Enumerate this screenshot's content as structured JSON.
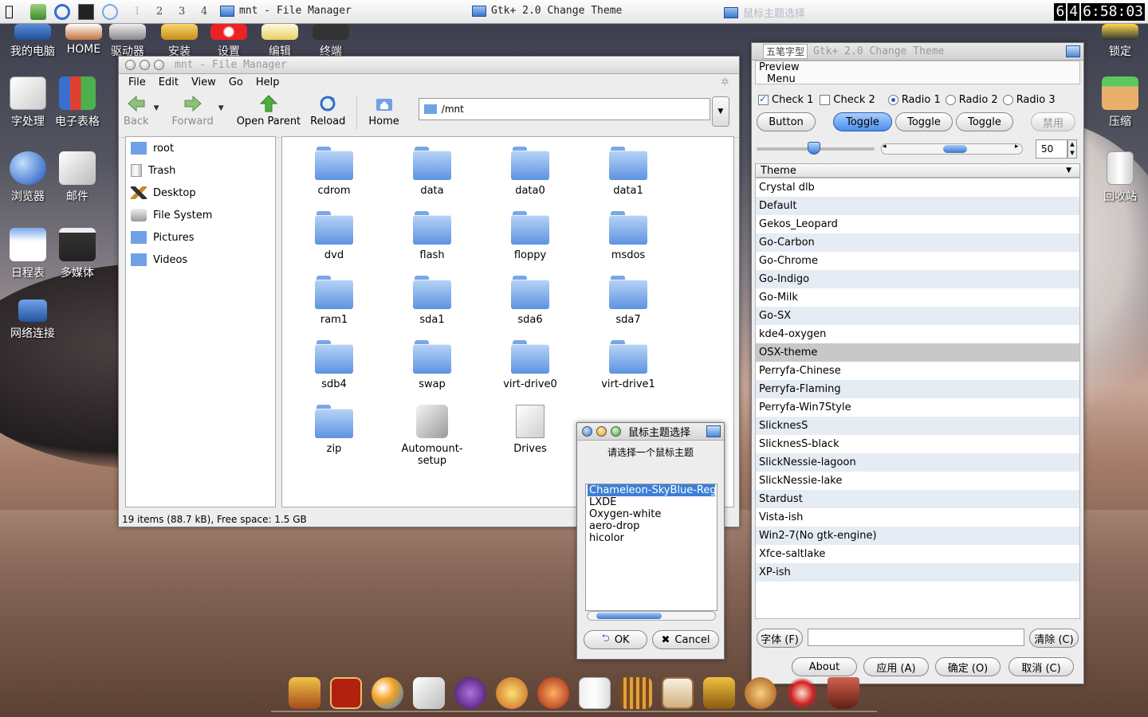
{
  "top_panel": {
    "workspaces": [
      "1",
      "2",
      "3",
      "4"
    ],
    "tasks": [
      "mnt - File Manager",
      "Gtk+ 2.0 Change Theme",
      "鼠标主题选择"
    ],
    "clock": {
      "a": "6",
      "b": "4",
      "time": "6:58:03"
    }
  },
  "desktop_left": [
    {
      "label": "我的电脑",
      "icon": "computer-icon"
    },
    {
      "label": "HOME",
      "icon": "home-icon"
    },
    {
      "label": "驱动器",
      "icon": "drive-icon"
    },
    {
      "label": "安装",
      "icon": "package-icon"
    },
    {
      "label": "设置",
      "icon": "settings-icon"
    },
    {
      "label": "编辑",
      "icon": "editor-icon"
    },
    {
      "label": "终端",
      "icon": "terminal-icon"
    },
    {
      "label": "字处理",
      "icon": "word-processor-icon"
    },
    {
      "label": "电子表格",
      "icon": "spreadsheet-icon"
    },
    {
      "label": "浏览器",
      "icon": "browser-icon"
    },
    {
      "label": "邮件",
      "icon": "mail-icon"
    },
    {
      "label": "日程表",
      "icon": "calendar-icon"
    },
    {
      "label": "多媒体",
      "icon": "multimedia-icon"
    },
    {
      "label": "网络连接",
      "icon": "network-icon"
    }
  ],
  "desktop_right": [
    {
      "label": "锁定",
      "icon": "lock-icon"
    },
    {
      "label": "压缩",
      "icon": "archive-icon"
    },
    {
      "label": "回收站",
      "icon": "recycle-bin-icon"
    }
  ],
  "file_manager": {
    "title": "mnt - File Manager",
    "menu": [
      "File",
      "Edit",
      "View",
      "Go",
      "Help"
    ],
    "toolbar": {
      "back": "Back",
      "forward": "Forward",
      "open_parent": "Open Parent",
      "reload": "Reload",
      "home": "Home"
    },
    "location": "/mnt",
    "places": [
      "root",
      "Trash",
      "Desktop",
      "File System",
      "Pictures",
      "Videos"
    ],
    "items": [
      "cdrom",
      "data",
      "data0",
      "data1",
      "dvd",
      "flash",
      "floppy",
      "msdos",
      "ram1",
      "sda1",
      "sda6",
      "sda7",
      "sdb4",
      "swap",
      "virt-drive0",
      "virt-drive1",
      "zip",
      "Automount-setup",
      "Drives"
    ],
    "status": "19 items (88.7 kB), Free space: 1.5 GB"
  },
  "theme_window": {
    "title": "Gtk+ 2.0 Change Theme",
    "input_method": "五笔字型",
    "preview_label": "Preview",
    "preview_menu": "Menu",
    "checks": [
      "Check 1",
      "Check 2"
    ],
    "radios": [
      "Radio 1",
      "Radio 2",
      "Radio 3"
    ],
    "buttons": [
      "Button",
      "Toggle",
      "Toggle",
      "Toggle",
      "禁用"
    ],
    "spin_value": "50",
    "theme_header": "Theme",
    "themes": [
      "Crystal dlb",
      "Default",
      "Gekos_Leopard",
      "Go-Carbon",
      "Go-Chrome",
      "Go-Indigo",
      "Go-Milk",
      "Go-SX",
      "kde4-oxygen",
      "OSX-theme",
      "Perryfa-Chinese",
      "Perryfa-Flaming",
      "Perryfa-Win7Style",
      "SlicknesS",
      "SlicknesS-black",
      "SlickNessie-lagoon",
      "SlickNessie-lake",
      "Stardust",
      "Vista-ish",
      "Win2-7(No gtk-engine)",
      "Xfce-saltlake",
      "XP-ish"
    ],
    "selected_theme": "OSX-theme",
    "font_button": "字体 (F)",
    "clear_button": "清除 (C)",
    "about": "About",
    "apply": "应用 (A)",
    "ok": "确定 (O)",
    "cancel": "取消 (C)"
  },
  "cursor_dialog": {
    "title": "鼠标主题选择",
    "prompt": "请选择一个鼠标主题",
    "items": [
      "Chameleon-SkyBlue-Regu",
      "LXDE",
      "Oxygen-white",
      "aero-drop",
      "hicolor"
    ],
    "ok": "OK",
    "cancel": "Cancel"
  },
  "colors": {
    "accent": "#3d7fd6",
    "selection": "#c8c8c8",
    "folder": "#6fa1e6"
  }
}
